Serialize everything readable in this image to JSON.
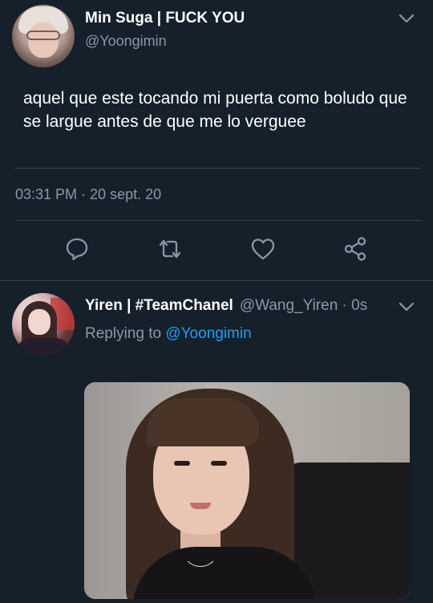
{
  "main_tweet": {
    "author_name": "Min Suga | FUCK YOU",
    "author_handle": "@Yoongimin",
    "text": "aquel que este tocando mi puerta como boludo que se largue antes de que me lo verguee",
    "timestamp": "03:31 PM · 20 sept. 20",
    "actions": [
      "reply-icon",
      "retweet-icon",
      "like-icon",
      "share-icon"
    ]
  },
  "reply_tweet": {
    "author_name": "Yiren | #TeamChanel",
    "meta": "@Wang_Yiren · 0s",
    "replying_prefix": "Replying to",
    "replying_mention": "@Yoongimin"
  },
  "colors": {
    "background": "#15202b",
    "primary_text": "#ffffff",
    "secondary_text": "#8899a6",
    "accent": "#1da1f2",
    "divider": "#38444d"
  }
}
